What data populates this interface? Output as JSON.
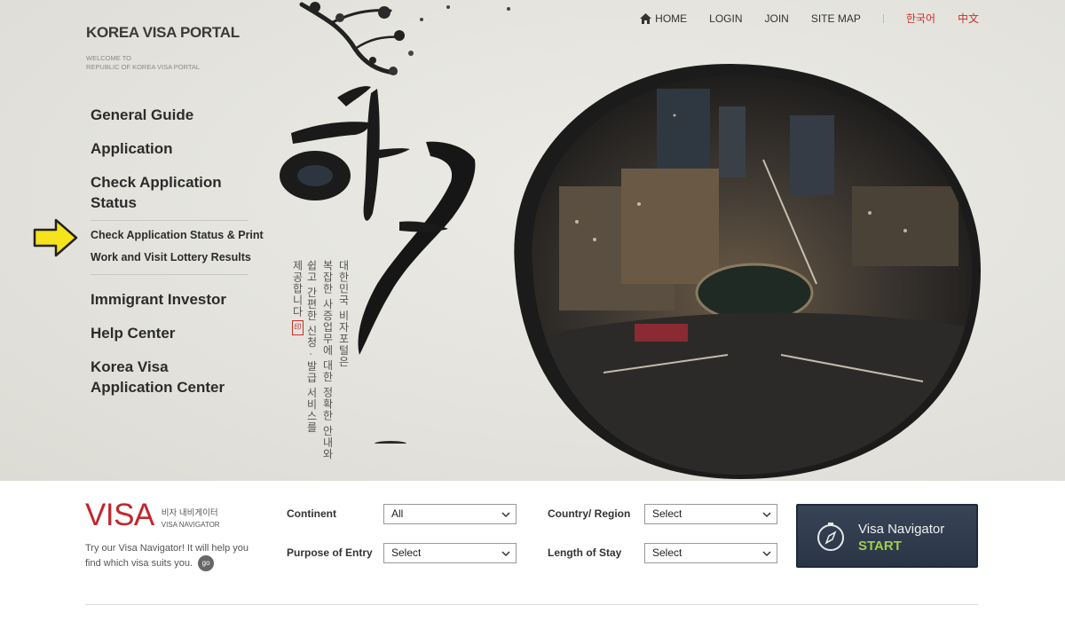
{
  "logo": {
    "title": "KOREA VISA PORTAL",
    "sub1": "WELCOME TO",
    "sub2": "REPUBLIC OF KOREA VISA PORTAL"
  },
  "topnav": {
    "home": "HOME",
    "login": "LOGIN",
    "join": "JOIN",
    "sitemap": "SITE MAP",
    "lang_ko": "한국어",
    "lang_zh": "中文"
  },
  "menu": {
    "general_guide": "General Guide",
    "application": "Application",
    "check_status_1": "Check Application",
    "check_status_2": "Status",
    "sub_print": "Check Application Status & Print",
    "sub_lottery": "Work and Visit Lottery Results",
    "investor": "Immigrant Investor",
    "help": "Help Center",
    "center_1": "Korea Visa",
    "center_2": "Application Center"
  },
  "hero": {
    "vertical_1": "대한민국 비자포털은",
    "vertical_2": "복잡한 사증업무에 대한 정확한 안내와",
    "vertical_3": "쉽고 간편한 신청 · 발급 서비스를",
    "vertical_4": "제공합니다"
  },
  "navigator": {
    "logo_big": "VISA",
    "logo_ko": "비자 내비게이터",
    "logo_en": "VISA NAVIGATOR",
    "desc": "Try our Visa Navigator! It will help you find which visa suits you.",
    "go": "go",
    "continent_label": "Continent",
    "continent_value": "All",
    "country_label": "Country/ Region",
    "country_value": "Select",
    "purpose_label": "Purpose of Entry",
    "purpose_value": "Select",
    "length_label": "Length of Stay",
    "length_value": "Select",
    "btn_line1": "Visa Navigator",
    "btn_line2": "START"
  },
  "colors": {
    "accent_red": "#c8312a",
    "visa_red": "#c0282e",
    "start_green": "#9fcf4a",
    "button_navy": "#2f3a4b"
  }
}
